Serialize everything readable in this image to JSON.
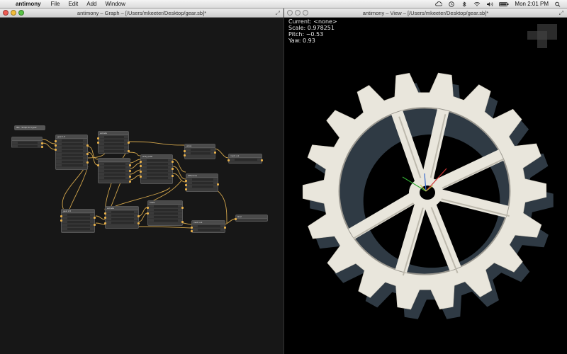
{
  "menubar": {
    "app_name": "antimony",
    "menus": [
      "File",
      "Edit",
      "Add",
      "Window"
    ],
    "clock": "Mon 2:01 PM"
  },
  "graph_window": {
    "title": "antimony – Graph – [/Users/mkeeter/Desktop/gear.sb]*"
  },
  "view_window": {
    "title": "antimony – View – [/Users/mkeeter/Desktop/gear.sb]*",
    "current": "Current: <none>",
    "scale": "Scale: 0.978251",
    "pitch": "Pitch: −0.53",
    "yaw": "Yaw: 0.93"
  },
  "colors": {
    "gear_face": "#e9e6dc",
    "gear_side": "#2f3a44",
    "wire": "#e8b652",
    "wire_green": "#b7c64a",
    "axis_x": "#cc3333",
    "axis_y": "#33aa33",
    "axis_z": "#3366cc"
  },
  "icons": [
    "apple-icon",
    "cloud-icon",
    "timemachine-icon",
    "bluetooth-icon",
    "wifi-icon",
    "volume-icon",
    "battery-icon",
    "search-icon"
  ]
}
